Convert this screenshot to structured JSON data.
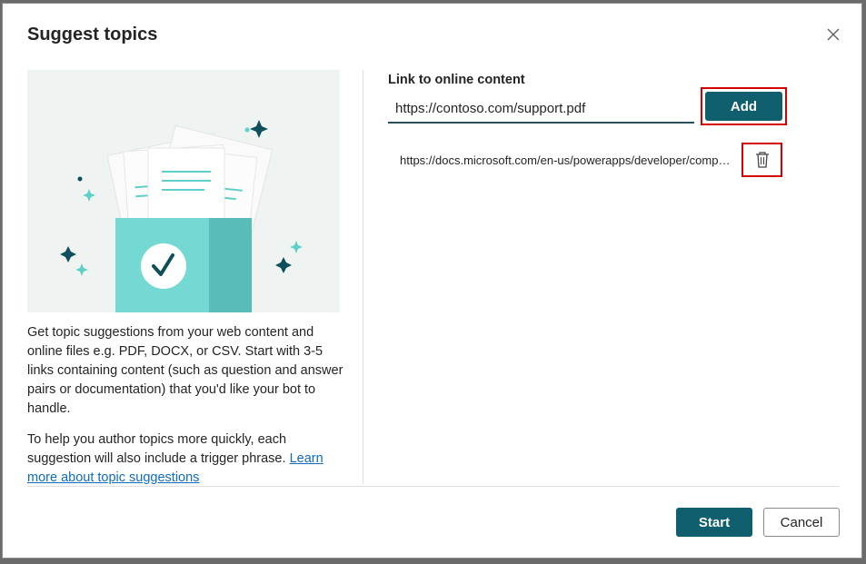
{
  "dialog": {
    "title": "Suggest topics",
    "close_icon": "close-icon"
  },
  "description": {
    "paragraph1": "Get topic suggestions from your web content and online files e.g. PDF, DOCX, or CSV. Start with 3-5 links containing content (such as question and answer pairs or documentation) that you'd like your bot to handle.",
    "paragraph2_text": "To help you author topics more quickly, each suggestion will also include a trigger phrase. ",
    "paragraph2_link": "Learn more about topic suggestions"
  },
  "form": {
    "label": "Link to online content",
    "input_value": "https://contoso.com/support.pdf",
    "add_label": "Add"
  },
  "links": [
    {
      "url": "https://docs.microsoft.com/en-us/powerapps/developer/component-framework/overview",
      "delete_icon": "trash-icon"
    }
  ],
  "footer": {
    "start_label": "Start",
    "cancel_label": "Cancel"
  },
  "colors": {
    "primary": "#0f5f6f",
    "highlight": "#d40000",
    "illustration_bg": "#eff4f3",
    "folder_teal": "#74d9d2"
  }
}
